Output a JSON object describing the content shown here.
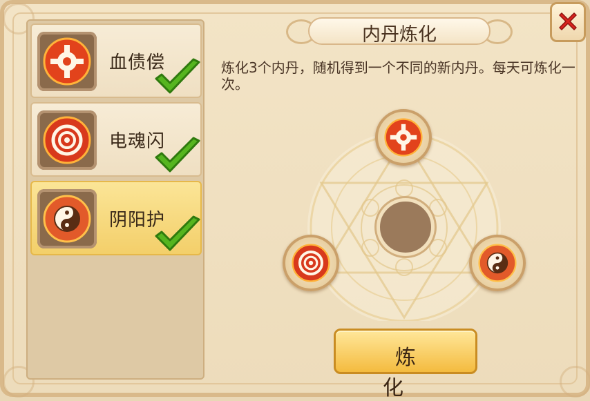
{
  "dialog": {
    "title": "内丹炼化",
    "description": "炼化3个内丹，随机得到一个不同的新内丹。每天可炼化一次。",
    "close_icon": "close-x-icon",
    "refine_button_label": "炼 化"
  },
  "skills": [
    {
      "name": "血债偿",
      "icon": "gear-pill-icon",
      "checked": true,
      "selected": false
    },
    {
      "name": "电魂闪",
      "icon": "swirl-pill-icon",
      "checked": true,
      "selected": false
    },
    {
      "name": "阴阳护",
      "icon": "yinyang-pill-icon",
      "checked": true,
      "selected": true
    }
  ],
  "slots": [
    {
      "position": "top",
      "icon": "gear-pill-icon"
    },
    {
      "position": "bottom-left",
      "icon": "swirl-pill-icon"
    },
    {
      "position": "bottom-right",
      "icon": "yinyang-pill-icon"
    }
  ],
  "colors": {
    "accent_gold": "#f4bb3f",
    "close_red": "#d8231e",
    "check_green": "#56b51f"
  }
}
